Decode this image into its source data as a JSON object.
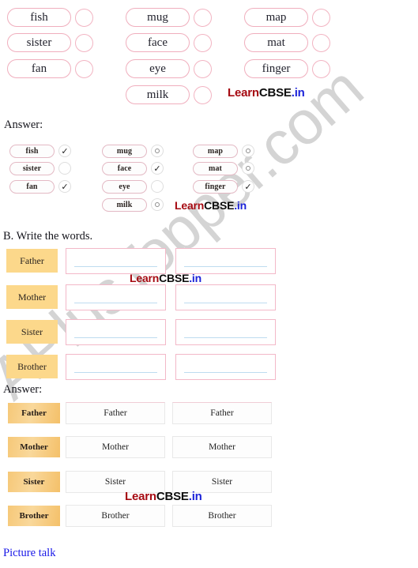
{
  "watermark": {
    "text": "APlusTopper.com"
  },
  "brand": {
    "part1": "Learn",
    "part2": "CBSE",
    "part3": ".in"
  },
  "section_a": {
    "columns": [
      {
        "items": [
          {
            "word": "fish"
          },
          {
            "word": "sister"
          },
          {
            "word": "fan"
          }
        ]
      },
      {
        "items": [
          {
            "word": "mug"
          },
          {
            "word": "face"
          },
          {
            "word": "eye"
          },
          {
            "word": "milk"
          }
        ]
      },
      {
        "items": [
          {
            "word": "map"
          },
          {
            "word": "mat"
          },
          {
            "word": "finger"
          }
        ]
      }
    ]
  },
  "section_a_answer": {
    "label": "Answer:",
    "tick_glyph": "✓",
    "columns": [
      {
        "items": [
          {
            "word": "fish",
            "mark": "tick"
          },
          {
            "word": "sister",
            "mark": "blank"
          },
          {
            "word": "fan",
            "mark": "tick"
          }
        ]
      },
      {
        "items": [
          {
            "word": "mug",
            "mark": "dot"
          },
          {
            "word": "face",
            "mark": "tick"
          },
          {
            "word": "eye",
            "mark": "blank"
          },
          {
            "word": "milk",
            "mark": "dot"
          }
        ]
      },
      {
        "items": [
          {
            "word": "map",
            "mark": "dot"
          },
          {
            "word": "mat",
            "mark": "dot"
          },
          {
            "word": "finger",
            "mark": "tick"
          }
        ]
      }
    ]
  },
  "section_b": {
    "heading": "B. Write the words.",
    "rows": [
      {
        "label": "Father",
        "col1": "",
        "col2": ""
      },
      {
        "label": "Mother",
        "col1": "",
        "col2": ""
      },
      {
        "label": "Sister",
        "col1": "",
        "col2": ""
      },
      {
        "label": "Brother",
        "col1": "",
        "col2": ""
      }
    ]
  },
  "section_b_answer": {
    "label": "Answer:",
    "rows": [
      {
        "label": "Father",
        "col1": "Father",
        "col2": "Father"
      },
      {
        "label": "Mother",
        "col1": "Mother",
        "col2": "Mother"
      },
      {
        "label": "Sister",
        "col1": "Sister",
        "col2": "Sister"
      },
      {
        "label": "Brother",
        "col1": "Brother",
        "col2": "Brother"
      }
    ]
  },
  "footer": {
    "picture_talk": "Picture talk"
  }
}
